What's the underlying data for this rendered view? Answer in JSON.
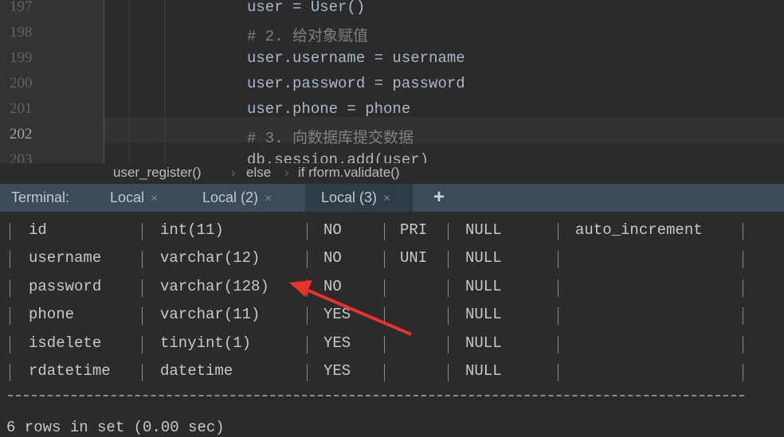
{
  "editor": {
    "lines": [
      {
        "num": "197",
        "code": "user = User()",
        "comment": false
      },
      {
        "num": "198",
        "code": "# 2. 给对象赋值",
        "comment": true
      },
      {
        "num": "199",
        "code": "user.username = username",
        "comment": false
      },
      {
        "num": "200",
        "code": "user.password = password",
        "comment": false
      },
      {
        "num": "201",
        "code": "user.phone = phone",
        "comment": false
      },
      {
        "num": "202",
        "code": "# 3. 向数据库提交数据",
        "comment": true
      },
      {
        "num": "203",
        "code": "db.session.add(user)",
        "comment": false
      }
    ],
    "current_line": "202"
  },
  "breadcrumb": [
    "user_register()",
    "else",
    "if rform.validate()"
  ],
  "breadcrumb_separator": "›",
  "terminal": {
    "label": "Terminal:",
    "tabs": [
      {
        "label": "Local"
      },
      {
        "label": "Local (2)"
      },
      {
        "label": "Local (3)",
        "active": true
      }
    ],
    "close_glyph": "×",
    "add_glyph": "+",
    "rows": [
      [
        "id",
        "int(11)",
        "NO",
        "PRI",
        "NULL",
        "auto_increment"
      ],
      [
        "username",
        "varchar(12)",
        "NO",
        "UNI",
        "NULL",
        ""
      ],
      [
        "password",
        "varchar(128)",
        "NO",
        "",
        "NULL",
        ""
      ],
      [
        "phone",
        "varchar(11)",
        "YES",
        "",
        "NULL",
        ""
      ],
      [
        "isdelete",
        "tinyint(1)",
        "YES",
        "",
        "NULL",
        ""
      ],
      [
        "rdatetime",
        "datetime",
        "YES",
        "",
        "NULL",
        ""
      ]
    ],
    "footer": "6 rows in set (0.00 sec)"
  },
  "colors": {
    "annotation_arrow": "#e8312a",
    "tab_bar": "#3c4b5a"
  }
}
